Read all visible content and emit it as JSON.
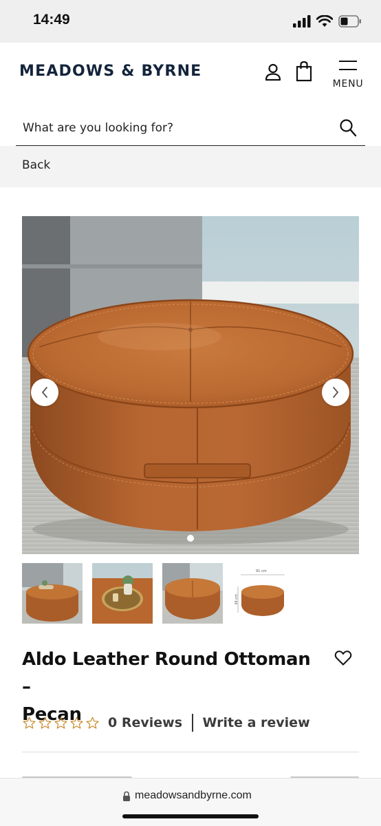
{
  "status_bar": {
    "time": "14:49",
    "icons": [
      "cellular-signal-icon",
      "wifi-icon",
      "battery-icon"
    ]
  },
  "header": {
    "logo": "MEADOWS & BYRNE",
    "menu_label": "MENU",
    "icons": [
      "account-icon",
      "shopping-bag-icon",
      "hamburger-menu-icon"
    ]
  },
  "search": {
    "placeholder": "What are you looking for?",
    "value": ""
  },
  "nav": {
    "back_label": "Back"
  },
  "gallery": {
    "slide_count": 1,
    "active_slide": 1,
    "arrows": [
      "chevron-left-icon",
      "chevron-right-icon"
    ],
    "thumbnails": [
      {
        "name": "ottoman-living-room-thumbnail"
      },
      {
        "name": "ottoman-with-tray-thumbnail"
      },
      {
        "name": "ottoman-front-view-thumbnail"
      },
      {
        "name": "ottoman-dimensions-thumbnail",
        "width_label": "91 cm",
        "height_label": "34 cm"
      }
    ]
  },
  "product": {
    "title_line1": "Aldo Leather Round Ottoman –",
    "title_line2": "Pecan",
    "rating": 0,
    "max_rating": 5,
    "reviews_label": "0 Reviews",
    "write_review_label": "Write a review"
  },
  "browser": {
    "url": "meadowsandbyrne.com"
  },
  "colors": {
    "brand_navy": "#14243c",
    "leather": "#b8672e",
    "star_outline": "#c98a2b",
    "status_bar_bg": "#efefef",
    "back_bar_bg": "#f3f3f3"
  }
}
